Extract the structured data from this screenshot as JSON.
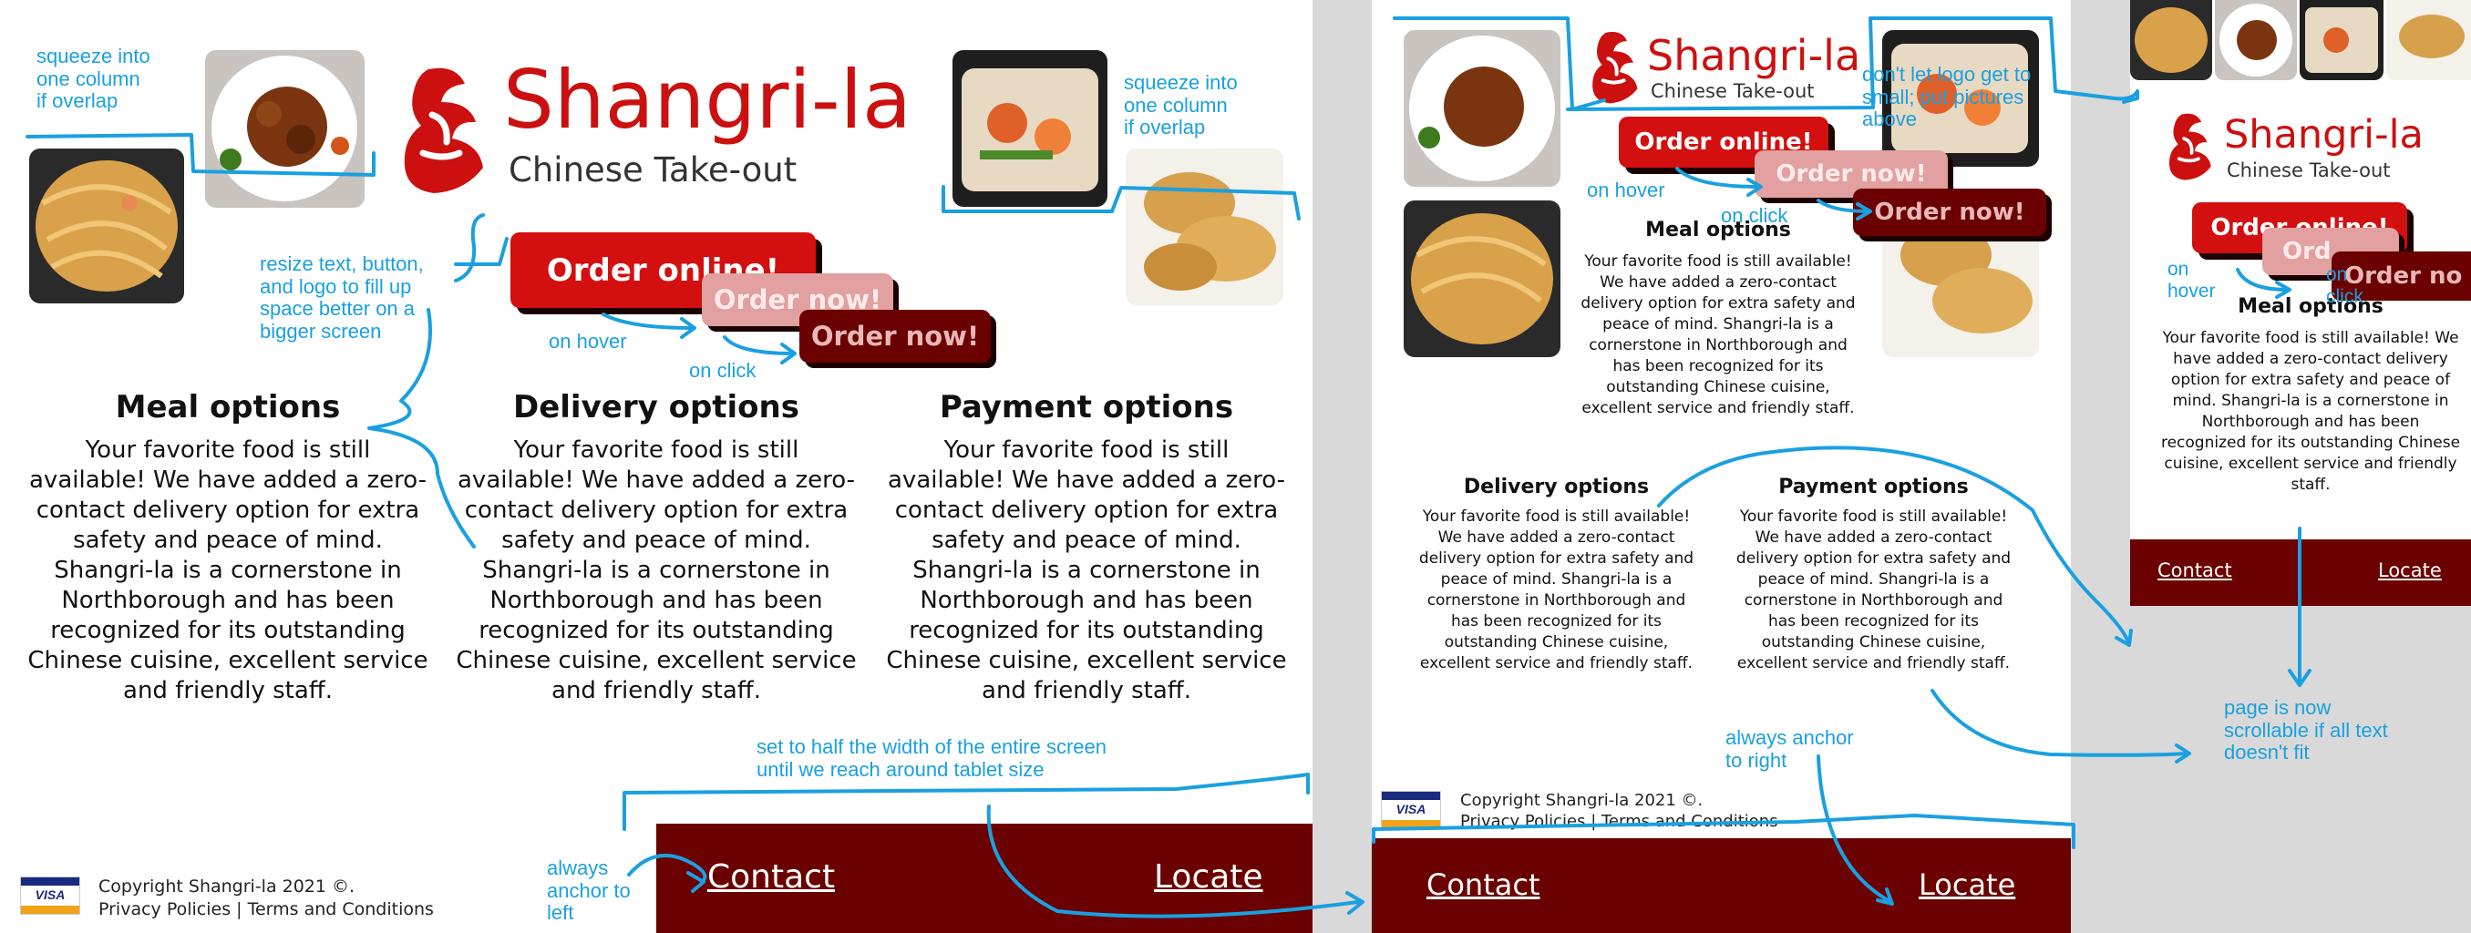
{
  "brand": {
    "name": "Shangri-la",
    "tagline": "Chinese Take-out"
  },
  "buttons": {
    "order_label": "Order online!",
    "order_short": "Order now!",
    "order_cut": "Order online!",
    "order_cut_hover": "Ord",
    "order_cut_click": "Order no"
  },
  "sections": {
    "meal_title": "Meal options",
    "delivery_title": "Delivery options",
    "payment_title": "Payment options",
    "body": "Your favorite food is still available! We have added a zero-contact delivery option for extra safety and peace of mind. Shangri-la is a cornerstone in Northborough and has been recognized for its outstanding Chinese cuisine, excellent service and friendly staff."
  },
  "footer": {
    "contact": "Contact",
    "locate": "Locate",
    "copyright": "Copyright Shangri-la 2021 ©.",
    "policies": "Privacy Policies | Terms and Conditions",
    "visa": "VISA"
  },
  "annotations": {
    "squeeze_left": "squeeze into\none column\nif overlap",
    "squeeze_right": "squeeze into\none column\nif overlap",
    "resize": "resize text, button,\nand logo to fill up\nspace better on a\nbigger screen",
    "on_hover": "on hover",
    "on_click": "on click",
    "half_width": "set to half the width of the entire screen\nuntil we reach around tablet size",
    "anchor_left": "always\nanchor to\nleft",
    "logo_small": "don't let logo get to\nsmall; put pictures\nabove",
    "on_hover_2": "on hover",
    "on_click_2": "on click",
    "anchor_right": "always anchor\nto right",
    "scrollable": "page is now\nscrollable if all text\ndoesn't fit",
    "on_hover_3": "on\nhover",
    "on_click_3": "on\nclick"
  },
  "colors": {
    "brand_red": "#cc1010",
    "button_red": "#d30f0f",
    "footer_maroon": "#6b0000",
    "annotation_blue": "#1aa0e0"
  }
}
